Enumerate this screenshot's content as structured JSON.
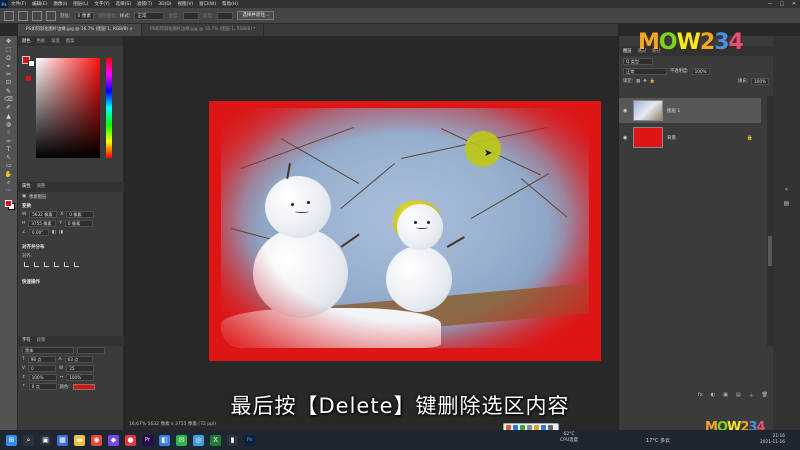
{
  "menubar": {
    "logo": "Ps",
    "items": [
      "文件(F)",
      "编辑(E)",
      "图像(I)",
      "图层(L)",
      "文字(Y)",
      "选择(S)",
      "滤镜(T)",
      "3D(D)",
      "视图(V)",
      "窗口(W)",
      "帮助(H)"
    ],
    "window_buttons": [
      "—",
      "□",
      "✕"
    ]
  },
  "options_bar": {
    "feather_label": "羽化:",
    "feather_value": "0 像素",
    "antialias_label": "消除锯齿",
    "style_label": "样式:",
    "style_value": "正常",
    "width_label": "宽度:",
    "height_label": "高度:",
    "select_mask_button": "选择并遮住..."
  },
  "tabs": [
    {
      "label": "PS如何羽化图片边缘.jpg @ 16.7% (图层 1, RGB/8) ×",
      "active": true
    },
    {
      "label": "PS如何羽化图片边缘.jpg @ 16.7% (图层 1, RGB/8) *",
      "active": false
    }
  ],
  "toolbar": {
    "tools": [
      "✥",
      "⬚",
      "ʘ",
      "⌖",
      "✂",
      "⊡",
      "✎",
      "⌫",
      "✐",
      "▲",
      "◍",
      "☝",
      "✑",
      "T",
      "↖",
      "▭",
      "✋",
      "⌕",
      "⋯"
    ]
  },
  "color_panel": {
    "tabs": [
      "颜色",
      "色板",
      "渐变",
      "图案"
    ],
    "fg_color": "#e01010",
    "bg_color": "#ffffff"
  },
  "properties_panel": {
    "tabs": [
      "属性",
      "调整"
    ],
    "pixel_layer": "像素图层",
    "transform_title": "变换",
    "w_label": "W",
    "w_value": "5632 像素",
    "x_label": "X",
    "x_value": "0 像素",
    "h_label": "H",
    "h_value": "3755 像素",
    "y_label": "Y",
    "y_value": "0 像素",
    "angle_value": "0.00°",
    "align_title": "对齐并分布",
    "align_to": "对齐:",
    "quick_title": "快速操作"
  },
  "character_panel": {
    "tabs": [
      "字符",
      "段落"
    ],
    "font_family": "黑体",
    "font_size": "98 点",
    "leading": "63 点",
    "kerning": "0",
    "tracking": "25",
    "scale_v": "100%",
    "scale_h": "100%",
    "baseline": "0 点",
    "color_label": "颜色:",
    "color_value": "#e01010"
  },
  "canvas": {
    "document_bg": "#dd1515",
    "status_text": "16.67%   5632 像素 x 3755 像素 (72 ppi)"
  },
  "subtitle": "最后按【Delete】键删除选区内容",
  "layers_panel": {
    "tabs": [
      "图层",
      "通道",
      "路径"
    ],
    "filter_label": "Q 类型",
    "blend_mode": "正常",
    "opacity_label": "不透明度:",
    "opacity_value": "100%",
    "lock_label": "锁定:",
    "fill_label": "填充:",
    "fill_value": "100%",
    "layers": [
      {
        "name": "图层 1",
        "selected": true,
        "visible": true
      },
      {
        "name": "背景",
        "selected": false,
        "visible": true,
        "locked": true
      }
    ],
    "bottom_icons": [
      "fx",
      "◐",
      "▣",
      "▤",
      "＋",
      "🗑"
    ]
  },
  "logo": {
    "text": "MOW234",
    "colors": [
      "#f5a623",
      "#7ed321",
      "#f8e71c",
      "#f5a623",
      "#4a90e2",
      "#e94e77"
    ]
  },
  "taskbar": {
    "apps": [
      {
        "name": "windows",
        "glyph": "⊞",
        "color": "#2f8ff0"
      },
      {
        "name": "search",
        "glyph": "⌕",
        "color": "#2a3440"
      },
      {
        "name": "taskview",
        "glyph": "▣",
        "color": "#2a3440"
      },
      {
        "name": "widgets",
        "glyph": "▦",
        "color": "#3b6fd8"
      },
      {
        "name": "explorer",
        "glyph": "▬",
        "color": "#f0c040"
      },
      {
        "name": "chrome",
        "glyph": "◉",
        "color": "#e04a3a"
      },
      {
        "name": "app1",
        "glyph": "◆",
        "color": "#7a4ae0"
      },
      {
        "name": "app2",
        "glyph": "●",
        "color": "#e03a3a"
      },
      {
        "name": "premiere",
        "glyph": "Pr",
        "color": "#2a0a4a"
      },
      {
        "name": "app3",
        "glyph": "◧",
        "color": "#3a80e0"
      },
      {
        "name": "wechat",
        "glyph": "✉",
        "color": "#2fb34a"
      },
      {
        "name": "app4",
        "glyph": "◎",
        "color": "#3aa0e0"
      },
      {
        "name": "excel",
        "glyph": "X",
        "color": "#1f7a3a"
      },
      {
        "name": "app5",
        "glyph": "▮",
        "color": "#2a3440"
      },
      {
        "name": "photoshop",
        "glyph": "Ps",
        "color": "#0f1f3a"
      }
    ],
    "cpu_temp": "62°C",
    "cpu_label": "CPU温度",
    "weather": "17°C 多云",
    "time": "21:16",
    "date": "2021-11-16"
  }
}
